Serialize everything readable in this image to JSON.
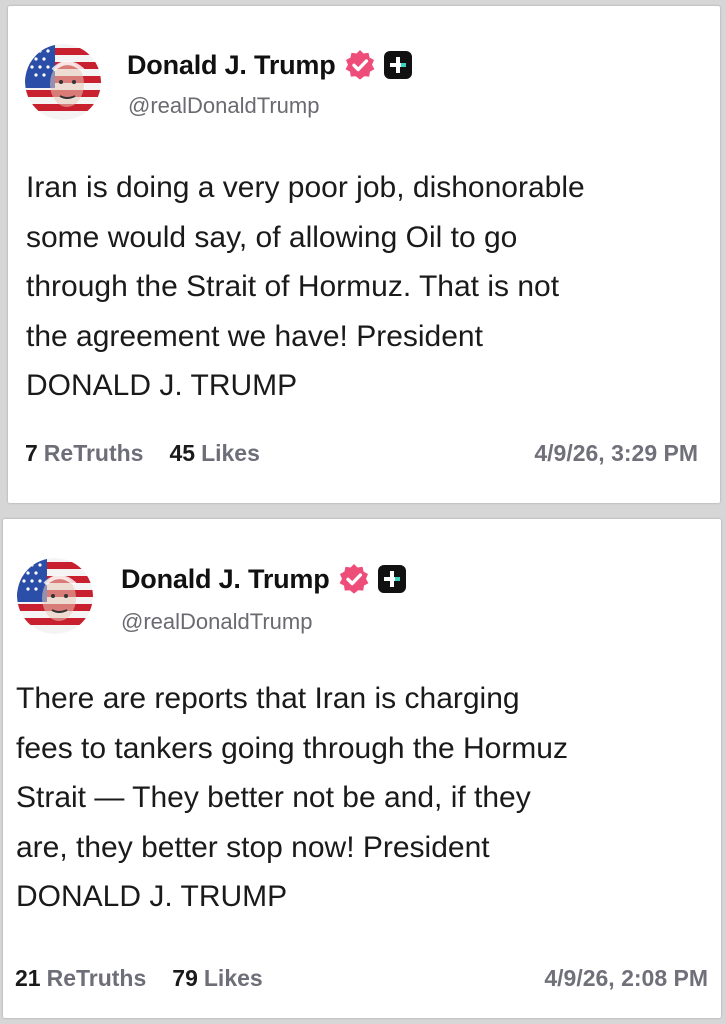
{
  "colors": {
    "background": "#d6d6d6",
    "card": "#ffffff",
    "text": "#1a1a1a",
    "muted": "#70707a",
    "verified": "#ee4d7a",
    "plus_badge_bg": "#111111",
    "plus_badge_fg": "#ffffff"
  },
  "posts": [
    {
      "author": {
        "display_name": "Donald J. Trump",
        "handle": "@realDonaldTrump",
        "avatar_icon": "flag-portrait-avatar",
        "verified_icon": "verified-badge-icon",
        "plus_icon": "plus-badge-icon"
      },
      "body_lines": [
        "Iran is doing a very poor job, dishonorable",
        "some would say, of allowing Oil to go",
        "through the Strait of Hormuz. That is not",
        "the agreement we have! President",
        "DONALD J. TRUMP"
      ],
      "retruths_count": "7",
      "retruths_label": "ReTruths",
      "likes_count": "45",
      "likes_label": "Likes",
      "timestamp": "4/9/26, 3:29 PM"
    },
    {
      "author": {
        "display_name": "Donald J. Trump",
        "handle": "@realDonaldTrump",
        "avatar_icon": "flag-portrait-avatar",
        "verified_icon": "verified-badge-icon",
        "plus_icon": "plus-badge-icon"
      },
      "body_lines": [
        "There are reports that Iran is charging",
        "fees to tankers going through the Hormuz",
        "Strait — They better not be and, if they",
        "are, they better stop now! President",
        "DONALD J. TRUMP"
      ],
      "retruths_count": "21",
      "retruths_label": "ReTruths",
      "likes_count": "79",
      "likes_label": "Likes",
      "timestamp": "4/9/26, 2:08 PM"
    }
  ]
}
